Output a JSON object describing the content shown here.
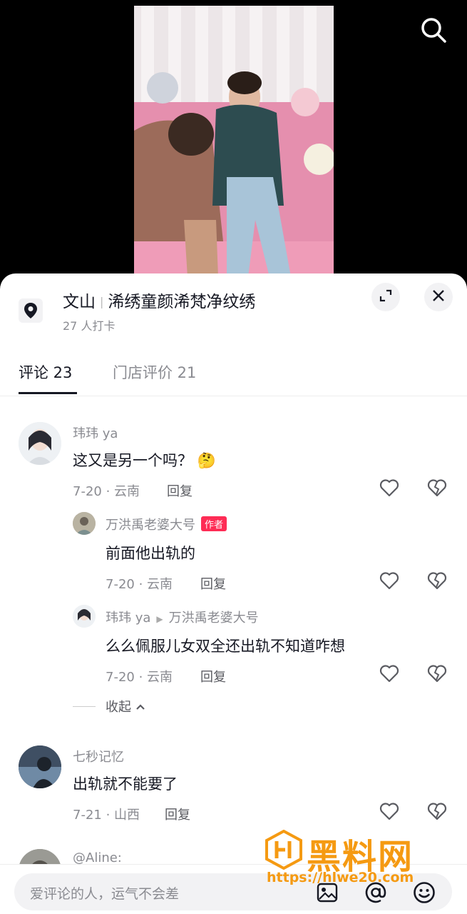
{
  "location": {
    "city": "文山",
    "shop": "浠绣童颜浠梵净纹绣",
    "checkins": "27 人打卡"
  },
  "tabs": [
    {
      "label": "评论 23"
    },
    {
      "label": "门店评价 21"
    }
  ],
  "comments": [
    {
      "author": "玮玮 ya",
      "text": "这又是另一个吗？",
      "emoji": "🤔",
      "date": "7-20 · 云南",
      "reply": "回复"
    },
    {
      "author": "万洪禹老婆大号",
      "badge": "作者",
      "text": "前面他出轨的",
      "date": "7-20 · 云南",
      "reply": "回复"
    },
    {
      "author": "玮玮 ya",
      "reply_to": "万洪禹老婆大号",
      "text": "么么佩服儿女双全还出轨不知道咋想",
      "date": "7-20 · 云南",
      "reply": "回复"
    },
    {
      "author": "七秒记忆",
      "text": "出轨就不能要了",
      "date": "7-21 · 山西",
      "reply": "回复"
    },
    {
      "author": "@Aline:"
    }
  ],
  "collapse_label": "收起",
  "input": {
    "placeholder": "爱评论的人，运气不会差"
  },
  "watermark": {
    "title": "黑料网",
    "url": "https://hlwe20.com"
  },
  "icons": [
    "search-icon",
    "location-pin-icon",
    "expand-icon",
    "close-icon",
    "heart-icon",
    "broken-heart-icon",
    "image-icon",
    "at-icon",
    "emoji-icon"
  ]
}
